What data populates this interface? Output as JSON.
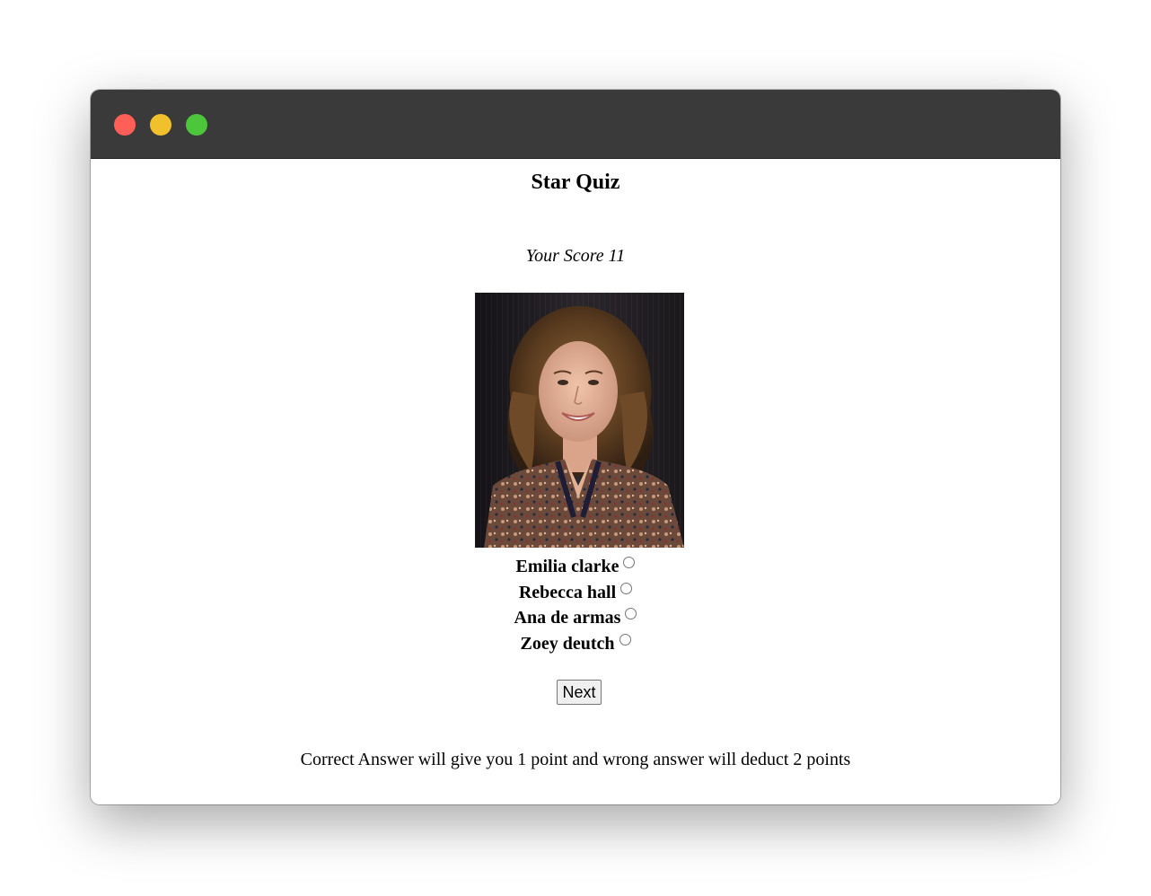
{
  "window": {
    "controls": [
      "close",
      "minimize",
      "maximize"
    ]
  },
  "quiz": {
    "title": "Star Quiz",
    "score_text": "Your Score 11",
    "options": [
      {
        "label": "Emilia clarke"
      },
      {
        "label": "Rebecca hall"
      },
      {
        "label": "Ana de armas"
      },
      {
        "label": "Zoey deutch"
      }
    ],
    "next_label": "Next",
    "rules_text": "Correct Answer will give you 1 point and wrong answer will deduct 2 points"
  }
}
